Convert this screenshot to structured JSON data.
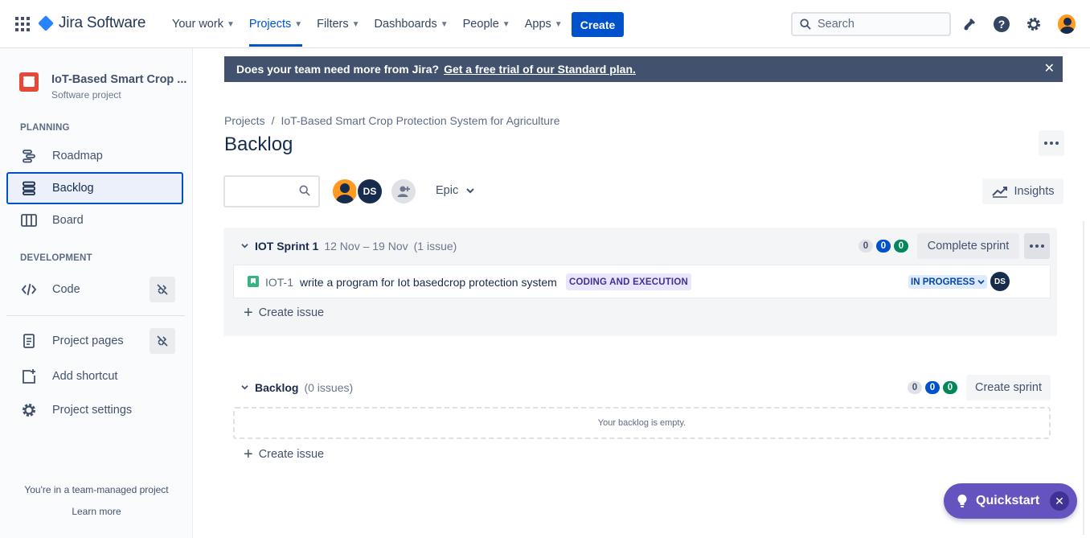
{
  "topbar": {
    "app_name": "Jira Software",
    "nav": [
      {
        "label": "Your work",
        "active": false
      },
      {
        "label": "Projects",
        "active": true
      },
      {
        "label": "Filters",
        "active": false
      },
      {
        "label": "Dashboards",
        "active": false
      },
      {
        "label": "People",
        "active": false
      },
      {
        "label": "Apps",
        "active": false
      }
    ],
    "create_label": "Create",
    "search_placeholder": "Search",
    "icons": [
      "notifications-icon",
      "help-icon",
      "settings-icon",
      "profile-avatar"
    ]
  },
  "sidebar": {
    "project_name": "IoT-Based Smart Crop ...",
    "project_type": "Software project",
    "planning_heading": "PLANNING",
    "development_heading": "DEVELOPMENT",
    "items": [
      {
        "label": "Roadmap",
        "icon": "roadmap-icon"
      },
      {
        "label": "Backlog",
        "icon": "backlog-icon",
        "active": true
      },
      {
        "label": "Board",
        "icon": "board-icon"
      },
      {
        "label": "Code",
        "icon": "code-icon"
      },
      {
        "label": "Project pages",
        "icon": "project-pages-icon"
      },
      {
        "label": "Add shortcut",
        "icon": "add-shortcut-icon"
      },
      {
        "label": "Project settings",
        "icon": "settings-icon"
      }
    ],
    "footer_text": "You're in a team-managed project",
    "learn_more": "Learn more"
  },
  "banner": {
    "text": "Does your team need more from Jira?",
    "link": "Get a free trial of our Standard plan."
  },
  "breadcrumb": {
    "root": "Projects",
    "separator": "/",
    "project": "IoT-Based Smart Crop Protection System for Agriculture"
  },
  "page_title": "Backlog",
  "toolbar": {
    "avatar_initials": "DS",
    "epic_label": "Epic",
    "insights_label": "Insights"
  },
  "sprint": {
    "name": "IOT Sprint 1",
    "dates": "12 Nov – 19 Nov",
    "issue_count": "(1 issue)",
    "counts": [
      "0",
      "0",
      "0"
    ],
    "complete_label": "Complete sprint",
    "issue": {
      "key": "IOT-1",
      "summary": "write a program for Iot basedcrop protection system",
      "epic": "CODING AND EXECUTION",
      "status": "IN PROGRESS",
      "assignee": "DS"
    },
    "create_issue": "Create issue"
  },
  "backlog": {
    "name": "Backlog",
    "issue_count": "(0 issues)",
    "counts": [
      "0",
      "0",
      "0"
    ],
    "create_sprint": "Create sprint",
    "empty_text": "Your backlog is empty.",
    "create_issue": "Create issue"
  },
  "quickstart": {
    "label": "Quickstart"
  },
  "colors": {
    "primary": "#0052cc",
    "banner": "#42526e",
    "quickstart": "#6554c0",
    "done_green": "#00875a"
  }
}
